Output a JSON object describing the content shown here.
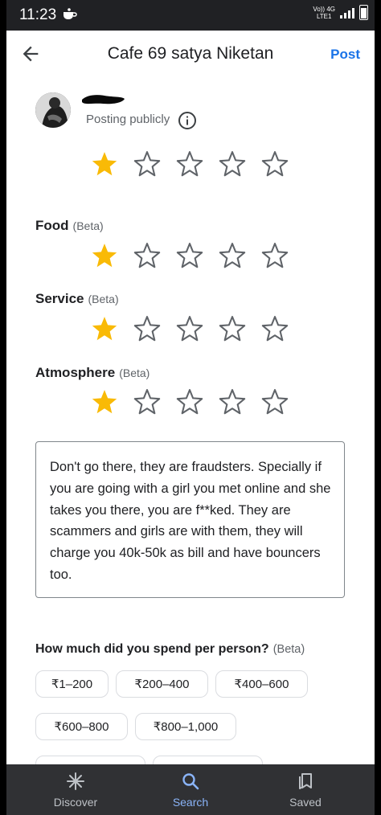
{
  "status_bar": {
    "time": "11:23",
    "network_line1": "Vo)) 4G",
    "network_line2": "LTE1"
  },
  "header": {
    "back_icon": "arrow-back-icon",
    "title": "Cafe 69 satya Niketan",
    "post_label": "Post"
  },
  "user": {
    "posting_text": "Posting publicly",
    "info_icon": "info-icon"
  },
  "overall_rating": {
    "value": 1,
    "max": 5
  },
  "categories": [
    {
      "label": "Food",
      "beta": "(Beta)",
      "rating": 1,
      "max": 5
    },
    {
      "label": "Service",
      "beta": "(Beta)",
      "rating": 1,
      "max": 5
    },
    {
      "label": "Atmosphere",
      "beta": "(Beta)",
      "rating": 1,
      "max": 5
    }
  ],
  "review": {
    "text": "Don't go there, they are fraudsters. Specially if you are going with a girl you met online and she takes you there, you are f**ked. They are scammers and girls are with them, they will charge you 40k-50k as bill and have bouncers too."
  },
  "spend": {
    "question": "How much did you spend per person?",
    "beta": "(Beta)",
    "options": [
      "₹1–200",
      "₹200–400",
      "₹400–600",
      "₹600–800",
      "₹800–1,000"
    ]
  },
  "bottom_nav": {
    "items": [
      {
        "label": "Discover",
        "icon": "asterisk-icon",
        "active": false
      },
      {
        "label": "Search",
        "icon": "search-icon",
        "active": true
      },
      {
        "label": "Saved",
        "icon": "bookmarks-icon",
        "active": false
      }
    ]
  },
  "colors": {
    "star_filled": "#f9ba06",
    "star_empty_stroke": "#5f6368",
    "accent": "#1a73e8",
    "nav_active": "#8ab4f8"
  }
}
